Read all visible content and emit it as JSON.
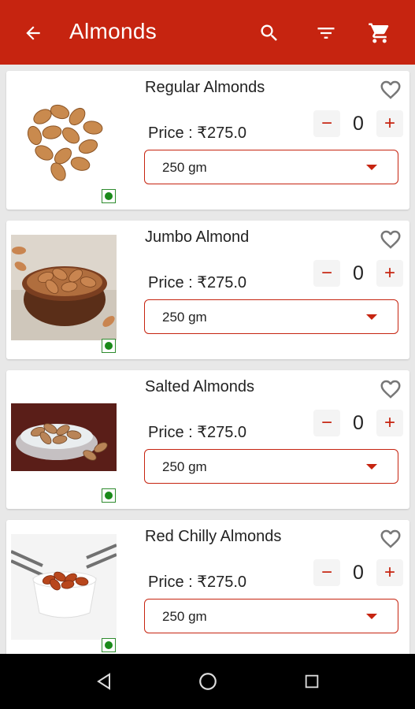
{
  "appbar": {
    "title": "Almonds",
    "icons": [
      "arrow-left-icon",
      "search-icon",
      "filter-icon",
      "cart-icon"
    ],
    "color": "#c62410"
  },
  "products": [
    {
      "name": "Regular Almonds",
      "price": "Price : ₹275.0",
      "quantity": "0",
      "minus": "−",
      "plus": "+",
      "weight": "250 gm"
    },
    {
      "name": "Jumbo Almond",
      "price": "Price : ₹275.0",
      "quantity": "0",
      "minus": "−",
      "plus": "+",
      "weight": "250 gm"
    },
    {
      "name": "Salted Almonds",
      "price": "Price : ₹275.0",
      "quantity": "0",
      "minus": "−",
      "plus": "+",
      "weight": "250 gm"
    },
    {
      "name": "Red Chilly Almonds",
      "price": "Price : ₹275.0",
      "quantity": "0",
      "minus": "−",
      "plus": "+",
      "weight": "250 gm"
    }
  ],
  "navbar": {
    "icons": [
      "back-triangle-icon",
      "home-circle-icon",
      "recents-square-icon"
    ]
  }
}
